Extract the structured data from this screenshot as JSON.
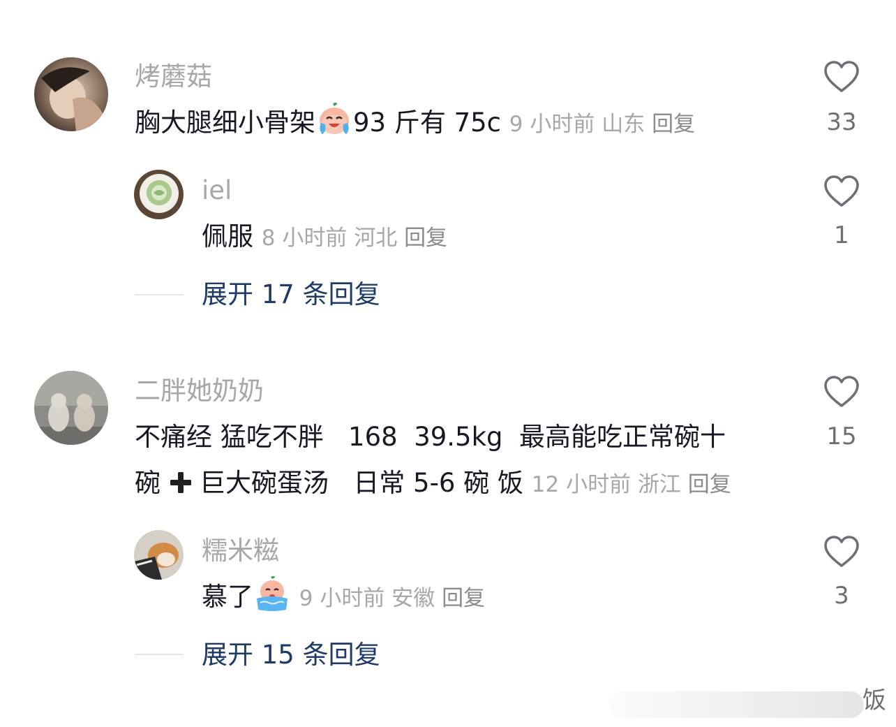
{
  "comments": [
    {
      "username": "烤蘑菇",
      "text_before_emoji": "胸大腿细小骨架",
      "emoji": "crying-laughing-peach-emoji",
      "text_after_emoji": "93 斤有 75c",
      "time": "9 小时前",
      "location": "山东",
      "reply_label": "回复",
      "likes": "33",
      "replies": [
        {
          "username": "iel",
          "text": "佩服",
          "time": "8 小时前",
          "location": "河北",
          "reply_label": "回复",
          "likes": "1"
        }
      ],
      "expand_label": "展开 17 条回复"
    },
    {
      "username": "二胖她奶奶",
      "line1": "不痛经 猛吃不胖   168  39.5kg  最高能吃正常碗十",
      "line2_a": "碗",
      "plus_icon": "heavy-plus-icon",
      "line2_b": "巨大碗蛋汤   日常 5-6 碗 饭",
      "time": "12 小时前",
      "location": "浙江",
      "reply_label": "回复",
      "likes": "15",
      "replies": [
        {
          "username": "糯米糍",
          "text": "慕了",
          "emoji": "crying-bath-peach-emoji",
          "time": "9 小时前",
          "location": "安徽",
          "reply_label": "回复",
          "likes": "3"
        }
      ],
      "expand_label": "展开 15 条回复"
    }
  ],
  "watermark": {
    "text": "饭"
  },
  "colors": {
    "primary_text": "#161823",
    "secondary_text": "#a6a7ab",
    "expand_link": "#1d3a68",
    "heart_outline": "#6e6f75"
  }
}
